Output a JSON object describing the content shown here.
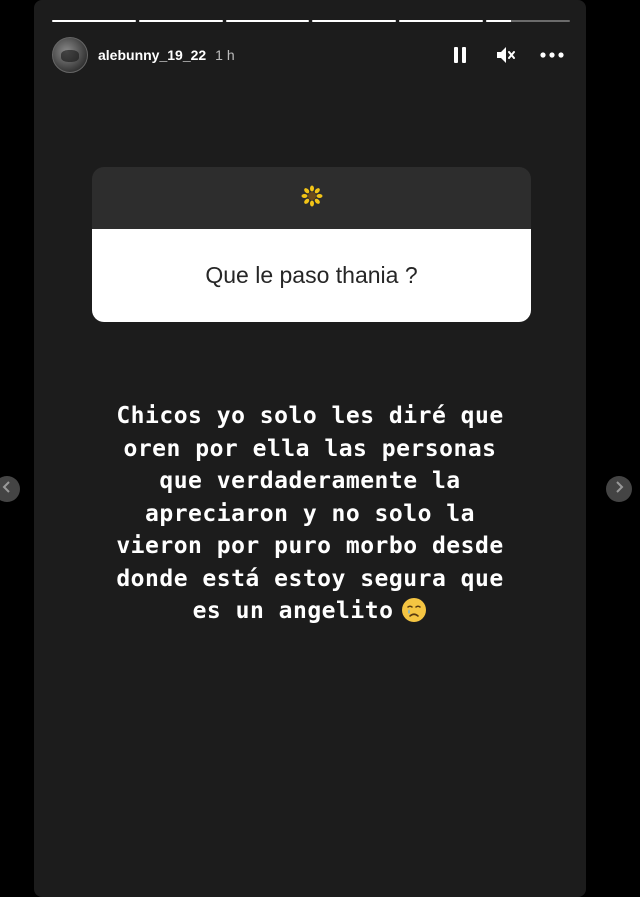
{
  "header": {
    "username": "alebunny_19_22",
    "time": "1 h",
    "progress_segments": [
      1,
      1,
      1,
      1,
      1,
      0.3
    ]
  },
  "icons": {
    "avatar": "profile-avatar",
    "pause": "pause-icon",
    "mute": "speaker-muted-icon",
    "more": "more-options-icon",
    "sticker": "sunflower-icon",
    "emoji": "crying-face-emoji",
    "prev": "chevron-left-icon",
    "next": "chevron-right-icon"
  },
  "question_sticker": {
    "question": "Que le paso thania  ?"
  },
  "story_text": {
    "lines": [
      "Chicos yo solo les diré que",
      "oren por ella las personas",
      "que verdaderamente la",
      "apreciaron y no solo la",
      "vieron por puro morbo desde",
      "donde está estoy segura que",
      "es un angelito"
    ]
  },
  "colors": {
    "background": "#000000",
    "story_bg": "#1c1c1c",
    "sticker_top": "#2d2d2d",
    "sticker_bottom": "#ffffff"
  }
}
